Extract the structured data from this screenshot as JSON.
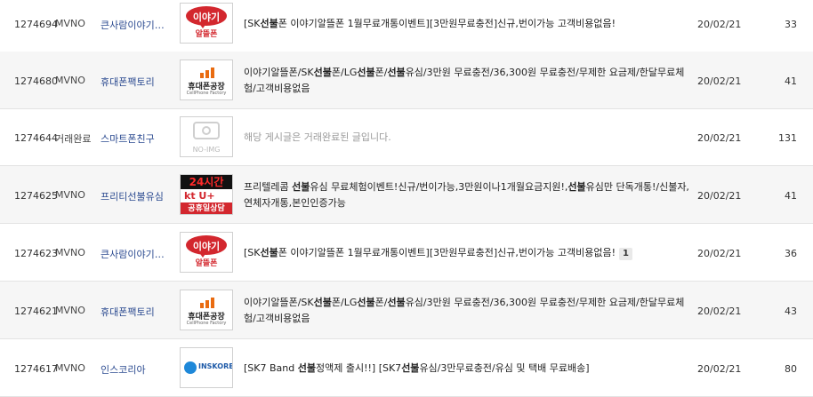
{
  "rows": [
    {
      "num": "1274694",
      "category": "MVNO",
      "writer": "큰사람이야기…",
      "thumb": {
        "type": "iyagi",
        "text": "이야기",
        "sub": "알뜰폰"
      },
      "title_parts": [
        {
          "t": "[SK"
        },
        {
          "t": "선불",
          "b": true
        },
        {
          "t": "폰 이야기알뜰폰 1월무료개통이벤트][3만원무료충전]신규,번이가능 고객비용없음!"
        }
      ],
      "badge": "",
      "date": "20/02/21",
      "views": "33"
    },
    {
      "num": "1274680",
      "category": "MVNO",
      "writer": "휴대폰팩토리",
      "thumb": {
        "type": "factory",
        "text": "휴대폰공장",
        "sub": "CellPhone Factory"
      },
      "title_parts": [
        {
          "t": "이야기알뜰폰/SK"
        },
        {
          "t": "선불",
          "b": true
        },
        {
          "t": "폰/LG"
        },
        {
          "t": "선불",
          "b": true
        },
        {
          "t": "폰/"
        },
        {
          "t": "선불",
          "b": true
        },
        {
          "t": "유심/3만원 무료충전/36,300원 무료충전/무제한 요금제/한달무료체험/고객비용없음"
        }
      ],
      "badge": "",
      "date": "20/02/21",
      "views": "41"
    },
    {
      "num": "1274644",
      "category": "거래완료",
      "writer": "스마트폰친구",
      "thumb": {
        "type": "noimg",
        "text": "NO-IMG"
      },
      "title_parts": [
        {
          "t": "해당 게시글은 거래완료된 글입니다."
        }
      ],
      "sold": true,
      "badge": "",
      "date": "20/02/21",
      "views": "131"
    },
    {
      "num": "1274625",
      "category": "MVNO",
      "writer": "프리티선불유심",
      "thumb": {
        "type": "kt24",
        "text": "24시간",
        "mid": "kt U+",
        "sub": "공휴일상담"
      },
      "title_parts": [
        {
          "t": "프리텔레콤 "
        },
        {
          "t": "선불",
          "b": true
        },
        {
          "t": "유심 무료체험이벤트!신규/번이가능,3만원이나1개월요금지원!,"
        },
        {
          "t": "선불",
          "b": true
        },
        {
          "t": "유심만 단독개통!/신불자,연체자개통,본인인증가능"
        }
      ],
      "badge": "",
      "date": "20/02/21",
      "views": "41"
    },
    {
      "num": "1274623",
      "category": "MVNO",
      "writer": "큰사람이야기…",
      "thumb": {
        "type": "iyagi",
        "text": "이야기",
        "sub": "알뜰폰"
      },
      "title_parts": [
        {
          "t": "[SK"
        },
        {
          "t": "선불",
          "b": true
        },
        {
          "t": "폰 이야기알뜰폰 1월무료개통이벤트][3만원무료충전]신규,번이가능 고객비용없음!"
        }
      ],
      "badge": "1",
      "date": "20/02/21",
      "views": "36"
    },
    {
      "num": "1274621",
      "category": "MVNO",
      "writer": "휴대폰팩토리",
      "thumb": {
        "type": "factory",
        "text": "휴대폰공장",
        "sub": "CellPhone Factory"
      },
      "title_parts": [
        {
          "t": "이야기알뜰폰/SK"
        },
        {
          "t": "선불",
          "b": true
        },
        {
          "t": "폰/LG"
        },
        {
          "t": "선불",
          "b": true
        },
        {
          "t": "폰/"
        },
        {
          "t": "선불",
          "b": true
        },
        {
          "t": "유심/3만원 무료충전/36,300원 무료충전/무제한 요금제/한달무료체험/고객비용없음"
        }
      ],
      "badge": "",
      "date": "20/02/21",
      "views": "43"
    },
    {
      "num": "1274617",
      "category": "MVNO",
      "writer": "인스코리아",
      "thumb": {
        "type": "inskorea",
        "text": "INSKOREA"
      },
      "title_parts": [
        {
          "t": "[SK7 Band "
        },
        {
          "t": "선불",
          "b": true
        },
        {
          "t": "정액제 출시!!] [SK7"
        },
        {
          "t": "선불",
          "b": true
        },
        {
          "t": "유심/3만무료충전/유심 및 택배 무료배송]"
        }
      ],
      "badge": "",
      "date": "20/02/21",
      "views": "80"
    }
  ]
}
